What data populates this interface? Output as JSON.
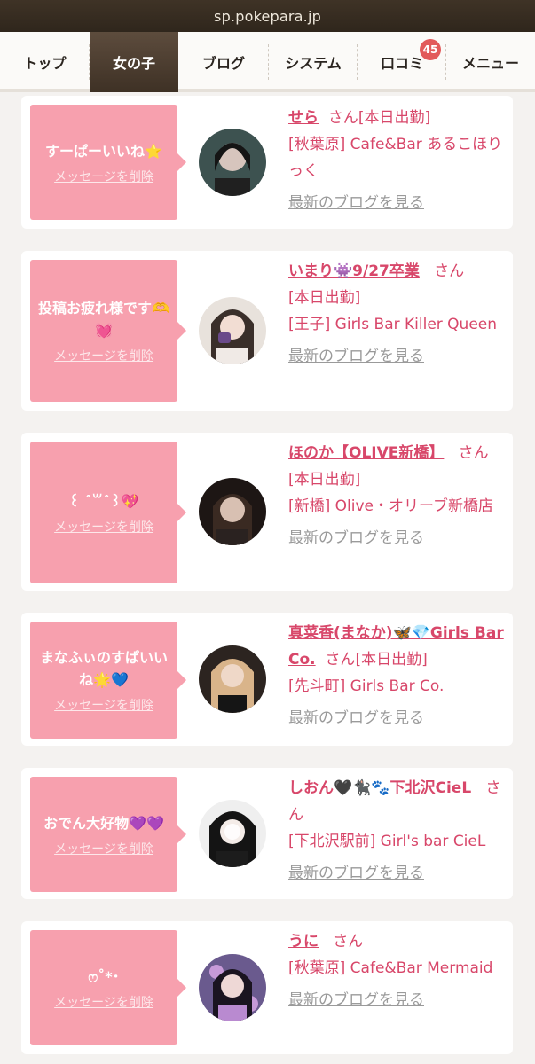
{
  "browser": {
    "url": "sp.pokepara.jp"
  },
  "nav": {
    "tabs": [
      {
        "label": "トップ"
      },
      {
        "label": "女の子"
      },
      {
        "label": "ブログ"
      },
      {
        "label": "システム"
      },
      {
        "label": "口コミ",
        "badge": "45"
      },
      {
        "label": "メニュー"
      }
    ],
    "active_index": 1
  },
  "common": {
    "delete_label": "メッセージを削除",
    "blog_label": "最新のブログを見る",
    "san": "さん"
  },
  "colors": {
    "bubble": "#f7a0ae",
    "accent": "#d8476a",
    "header": "#3f3326"
  },
  "entries": [
    {
      "message": "すーぱーいいね⭐",
      "name": "せら",
      "after_san": "[本日出勤]",
      "location": "[秋葉原] Cafe&Bar あるこほりっく"
    },
    {
      "message": "投稿お疲れ様です🫶💓",
      "name": "いまり👾9/27卒業",
      "after_san": "",
      "location": "[本日出勤]\n[王子] Girls Bar Killer Queen"
    },
    {
      "message": "꒰ ˆ꒳ˆ꒱💖",
      "name": "ほのか【OLIVE新橋】",
      "after_san": "[本日出勤]",
      "location": "[新橋] Olive・オリーブ新橋店"
    },
    {
      "message": "まなふぃのすぱいいね🌟💙",
      "name": "真菜香(まなか)🦋💎Girls Bar Co.",
      "after_san": "[本日出勤]",
      "location": "[先斗町] Girls Bar Co."
    },
    {
      "message": "おでん大好物💜💜",
      "name": "しおん🖤🐈‍⬛🐾下北沢CieL",
      "after_san": "",
      "location": "[下北沢駅前] Girl's bar CieL"
    },
    {
      "message": "ෆ˚*･",
      "name": "うに",
      "after_san": "",
      "location": "[秋葉原] Cafe&Bar Mermaid"
    }
  ]
}
